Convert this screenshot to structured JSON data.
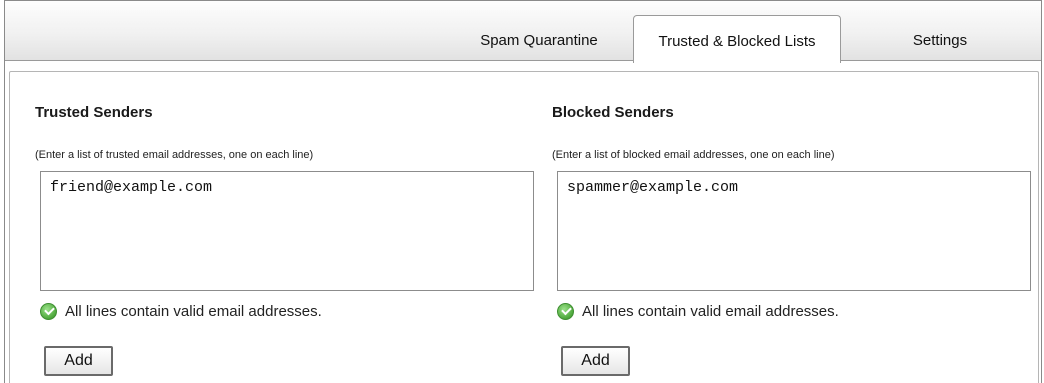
{
  "tabs": {
    "spam_quarantine": "Spam Quarantine",
    "trusted_blocked_lists": "Trusted & Blocked Lists",
    "settings": "Settings",
    "active": "trusted_blocked_lists"
  },
  "trusted": {
    "heading": "Trusted Senders",
    "hint": "(Enter a list of trusted email addresses, one on each line)",
    "value": "friend@example.com",
    "status": "All lines contain valid email addresses.",
    "button": "Add"
  },
  "blocked": {
    "heading": "Blocked Senders",
    "hint": "(Enter a list of blocked email addresses, one on each line)",
    "value": "spammer@example.com",
    "status": "All lines contain valid email addresses.",
    "button": "Add"
  },
  "icons": {
    "status": "check-circle-icon"
  },
  "colors": {
    "valid_green": "#4ea83c"
  }
}
